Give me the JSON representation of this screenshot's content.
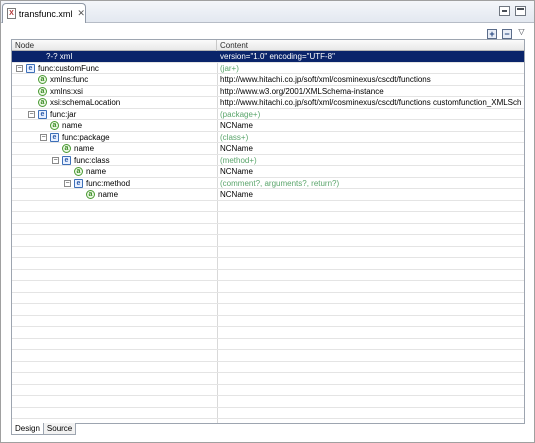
{
  "editor": {
    "tab_label": "transfunc.xml",
    "file_icon_glyph": "X"
  },
  "table": {
    "headers": {
      "node": "Node",
      "content": "Content"
    },
    "rows": [
      {
        "indent": 0,
        "twisty": "",
        "icon": "pi",
        "label": "?-? xml",
        "content": "version=\"1.0\" encoding=\"UTF-8\"",
        "hint": false,
        "selected": true
      },
      {
        "indent": 0,
        "twisty": "−",
        "icon": "element",
        "label": "func:customFunc",
        "content": "(jar+)",
        "hint": true,
        "selected": false
      },
      {
        "indent": 1,
        "twisty": "",
        "icon": "attribute",
        "label": "xmlns:func",
        "content": "http://www.hitachi.co.jp/soft/xml/cosminexus/cscdt/functions",
        "hint": false,
        "selected": false
      },
      {
        "indent": 1,
        "twisty": "",
        "icon": "attribute",
        "label": "xmlns:xsi",
        "content": "http://www.w3.org/2001/XMLSchema-instance",
        "hint": false,
        "selected": false
      },
      {
        "indent": 1,
        "twisty": "",
        "icon": "attribute",
        "label": "xsi:schemaLocation",
        "content": "http://www.hitachi.co.jp/soft/xml/cosminexus/cscdt/functions customfunction_XMLSch...",
        "hint": false,
        "selected": false
      },
      {
        "indent": 1,
        "twisty": "−",
        "icon": "element",
        "label": "func:jar",
        "content": "(package+)",
        "hint": true,
        "selected": false
      },
      {
        "indent": 2,
        "twisty": "",
        "icon": "attribute",
        "label": "name",
        "content": "NCName",
        "hint": false,
        "selected": false
      },
      {
        "indent": 2,
        "twisty": "−",
        "icon": "element",
        "label": "func:package",
        "content": "(class+)",
        "hint": true,
        "selected": false
      },
      {
        "indent": 3,
        "twisty": "",
        "icon": "attribute",
        "label": "name",
        "content": "NCName",
        "hint": false,
        "selected": false
      },
      {
        "indent": 3,
        "twisty": "−",
        "icon": "element",
        "label": "func:class",
        "content": "(method+)",
        "hint": true,
        "selected": false
      },
      {
        "indent": 4,
        "twisty": "",
        "icon": "attribute",
        "label": "name",
        "content": "NCName",
        "hint": false,
        "selected": false
      },
      {
        "indent": 4,
        "twisty": "−",
        "icon": "element",
        "label": "func:method",
        "content": "(comment?, arguments?, return?)",
        "hint": true,
        "selected": false
      },
      {
        "indent": 5,
        "twisty": "",
        "icon": "attribute",
        "label": "name",
        "content": "NCName",
        "hint": false,
        "selected": false
      }
    ],
    "empty_row_count": 19
  },
  "icons": {
    "element_glyph": "e",
    "attribute_glyph": "a",
    "expand_glyph": "+",
    "collapse_glyph": "−",
    "menu_glyph": "▽",
    "close_glyph": "✕"
  },
  "bottom_tabs": [
    {
      "label": "Design",
      "active": true
    },
    {
      "label": "Source",
      "active": false
    }
  ],
  "colors": {
    "selection": "#0a246a",
    "hint_text": "#5aa56b"
  }
}
